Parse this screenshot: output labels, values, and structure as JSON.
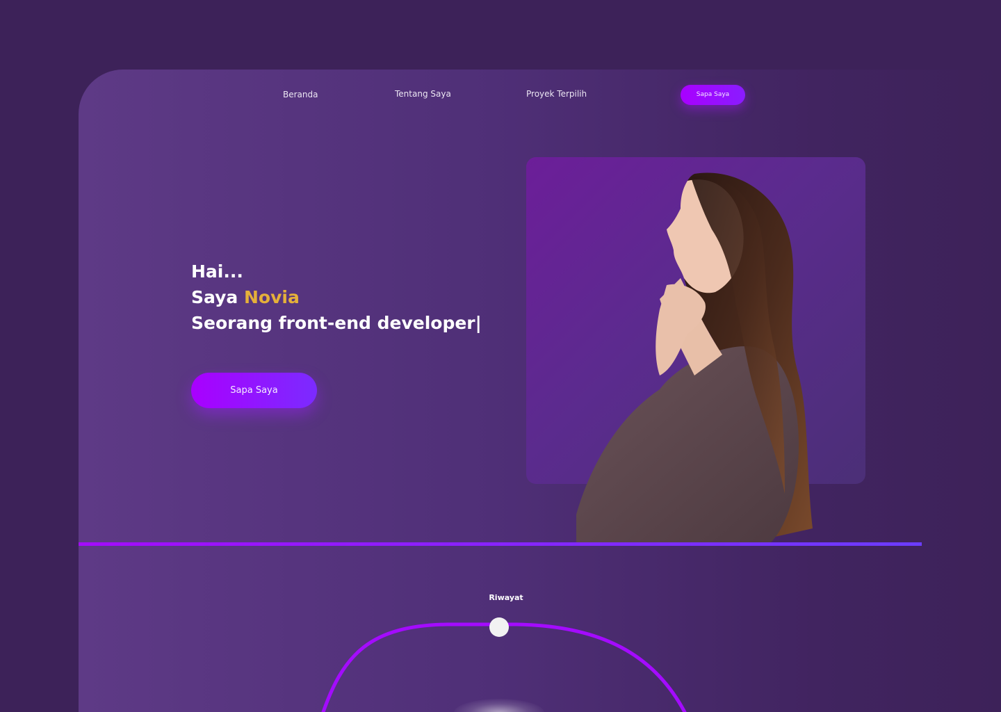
{
  "nav": {
    "items": [
      {
        "label": "Beranda"
      },
      {
        "label": "Tentang Saya"
      },
      {
        "label": "Proyek Terpilih"
      }
    ],
    "cta_label": "Sapa Saya"
  },
  "hero": {
    "line1": "Hai...",
    "line2_prefix": "Saya ",
    "line2_name": "Novia",
    "line3": "Seorang front-end developer|",
    "cta_label": "Sapa Saya"
  },
  "history": {
    "title": "Riwayat"
  },
  "colors": {
    "background": "#3d2259",
    "accent_purple": "#a900ff",
    "accent_gold": "#e5b03a"
  }
}
